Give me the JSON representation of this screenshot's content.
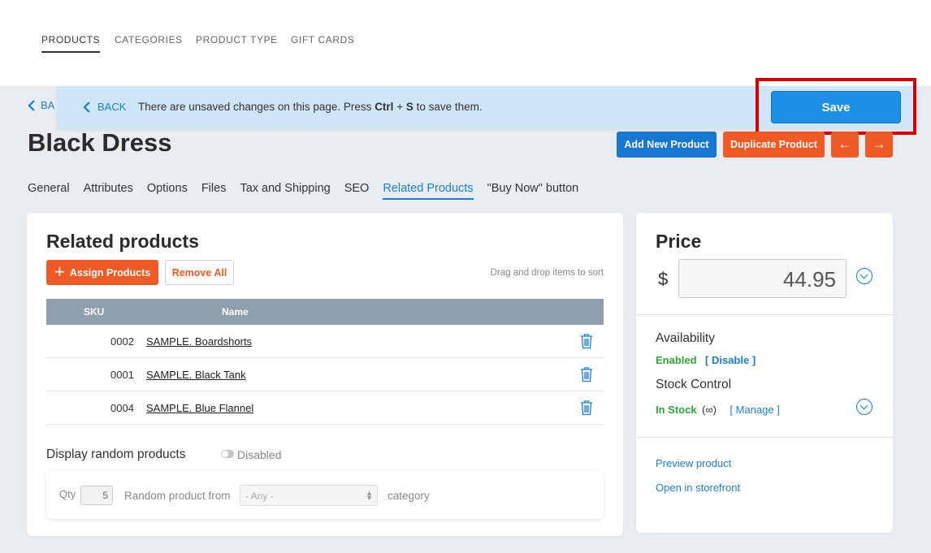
{
  "topnav": {
    "tabs": [
      {
        "label": "PRODUCTS",
        "active": true
      },
      {
        "label": "CATEGORIES",
        "active": false
      },
      {
        "label": "PRODUCT TYPE",
        "active": false
      },
      {
        "label": "GIFT CARDS",
        "active": false
      }
    ]
  },
  "under_back": {
    "label": "BA"
  },
  "unsaved": {
    "back_label": "BACK",
    "msg_pre": "There are unsaved changes on this page. Press ",
    "key1": "Ctrl",
    "plus": " + ",
    "key2": "S",
    "msg_post": " to save them.",
    "save_label": "Save"
  },
  "product": {
    "title": "Black Dress",
    "add_new_label": "Add New Product",
    "duplicate_label": "Duplicate Product",
    "prev_label": "←",
    "next_label": "→"
  },
  "subtabs": [
    {
      "label": "General"
    },
    {
      "label": "Attributes"
    },
    {
      "label": "Options"
    },
    {
      "label": "Files"
    },
    {
      "label": "Tax and Shipping"
    },
    {
      "label": "SEO"
    },
    {
      "label": "Related Products",
      "active": true
    },
    {
      "label": "\"Buy Now\" button"
    }
  ],
  "related": {
    "title": "Related products",
    "assign_label": "Assign Products",
    "remove_all_label": "Remove All",
    "drag_hint": "Drag and drop items to sort",
    "columns": {
      "sku": "SKU",
      "name": "Name"
    },
    "rows": [
      {
        "sku": "0002",
        "name": "SAMPLE. Boardshorts"
      },
      {
        "sku": "0001",
        "name": "SAMPLE. Black Tank"
      },
      {
        "sku": "0004",
        "name": "SAMPLE. Blue Flannel"
      }
    ],
    "random": {
      "label": "Display random products",
      "toggle_label": "Disabled",
      "qty_label": "Qty",
      "qty_value": "5",
      "from_label": "Random product from",
      "select_value": "- Any -",
      "category_label": "category"
    }
  },
  "price": {
    "title": "Price",
    "currency": "$",
    "value": "44.95",
    "availability_label": "Availability",
    "availability_status": "Enabled",
    "availability_action": "[ Disable ]",
    "stock_label": "Stock Control",
    "stock_status": "In Stock",
    "stock_qty": "(∞)",
    "stock_action": "[ Manage ]",
    "preview_link": "Preview product",
    "storefront_link": "Open in storefront"
  },
  "colors": {
    "accent_blue": "#1a7fd3",
    "save_blue": "#1e8fe6",
    "orange": "#f05a24",
    "green": "#2ea636",
    "highlight_red": "#d40000"
  }
}
